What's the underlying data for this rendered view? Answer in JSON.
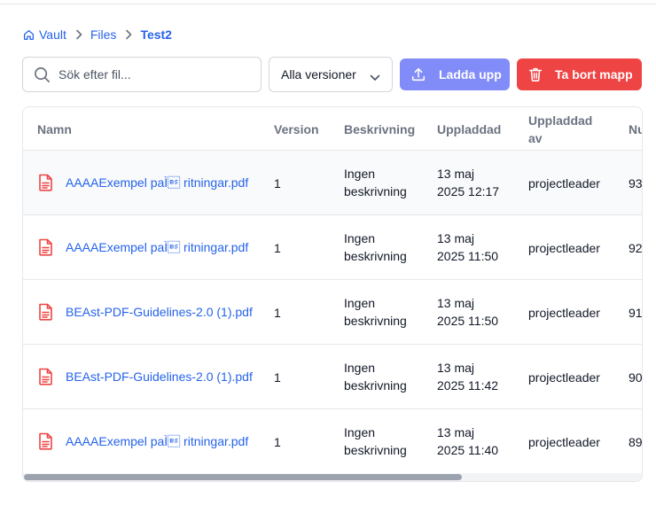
{
  "breadcrumb": {
    "items": [
      "Vault",
      "Files"
    ],
    "current": "Test2"
  },
  "toolbar": {
    "search_placeholder": "Sök efter fil...",
    "version_select": "Alla versioner",
    "upload_label": "Ladda upp",
    "delete_label": "Ta bort mapp"
  },
  "table": {
    "headers": {
      "name": "Namn",
      "version": "Version",
      "description": "Beskrivning",
      "uploaded": "Uppladdad",
      "uploaded_by_1": "Uppladdad",
      "uploaded_by_2": "av",
      "number": "Nu"
    },
    "rows": [
      {
        "name": "AAAAExempel paÌ\b ritningar.pdf",
        "version": "1",
        "desc1": "Ingen",
        "desc2": "beskrivning",
        "date1": "13 maj",
        "date2": "2025 12:17",
        "by": "projectleader",
        "num": "93"
      },
      {
        "name": "AAAAExempel paÌ\b ritningar.pdf",
        "version": "1",
        "desc1": "Ingen",
        "desc2": "beskrivning",
        "date1": "13 maj",
        "date2": "2025 11:50",
        "by": "projectleader",
        "num": "92"
      },
      {
        "name": "BEAst-PDF-Guidelines-2.0 (1).pdf",
        "version": "1",
        "desc1": "Ingen",
        "desc2": "beskrivning",
        "date1": "13 maj",
        "date2": "2025 11:50",
        "by": "projectleader",
        "num": "91"
      },
      {
        "name": "BEAst-PDF-Guidelines-2.0 (1).pdf",
        "version": "1",
        "desc1": "Ingen",
        "desc2": "beskrivning",
        "date1": "13 maj",
        "date2": "2025 11:42",
        "by": "projectleader",
        "num": "90"
      },
      {
        "name": "AAAAExempel paÌ\b ritningar.pdf",
        "version": "1",
        "desc1": "Ingen",
        "desc2": "beskrivning",
        "date1": "13 maj",
        "date2": "2025 11:40",
        "by": "projectleader",
        "num": "89"
      }
    ]
  },
  "colors": {
    "link": "#2563eb",
    "upload_button": "#818cf8",
    "delete_button": "#ef4444",
    "pdf_icon": "#ef4444"
  }
}
